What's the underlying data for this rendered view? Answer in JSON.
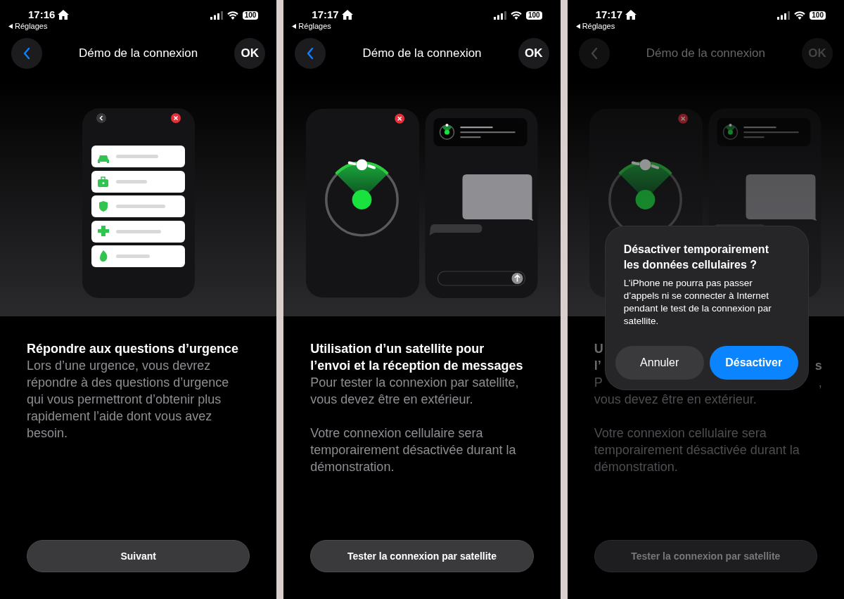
{
  "screens": [
    {
      "time": "17:16",
      "back_app": "Réglages",
      "battery": "100",
      "nav_title": "Démo de la connexion",
      "ok": "OK",
      "dimmed": false,
      "kind": "questions",
      "heading": "Répondre aux questions d’urgence",
      "paragraphs": [
        "Lors d’une urgence, vous devrez répondre à des questions d’urgence qui vous permettront d’obtenir plus rapidement l’aide dont vous avez besoin."
      ],
      "button": "Suivant"
    },
    {
      "time": "17:17",
      "back_app": "Réglages",
      "battery": "100",
      "nav_title": "Démo de la connexion",
      "ok": "OK",
      "dimmed": false,
      "kind": "satellite",
      "heading": "Utilisation d’un satellite pour l’envoi et la réception de messages",
      "paragraphs": [
        "Pour tester la connexion par satellite, vous devez être en extérieur.",
        "Votre connexion cellulaire sera temporairement désactivée durant la démonstration."
      ],
      "button": "Tester la connexion par satellite"
    },
    {
      "time": "17:17",
      "back_app": "Réglages",
      "battery": "100",
      "nav_title": "Démo de la connexion",
      "ok": "OK",
      "dimmed": true,
      "kind": "satellite",
      "covered_lines": [
        {
          "kind": "heading",
          "parts": [
            "U"
          ]
        },
        {
          "kind": "heading",
          "parts": [
            "l’",
            "s"
          ]
        },
        {
          "kind": "text",
          "parts": [
            "P",
            ","
          ]
        }
      ],
      "paragraphs": [
        "vous devez être en extérieur.",
        "Votre connexion cellulaire sera temporairement désactivée durant la démonstration."
      ],
      "button": "Tester la connexion par satellite",
      "dialog": {
        "title": "Désactiver temporairement les données cellulaires ?",
        "message": "L’iPhone ne pourra pas passer d’appels ni se connecter à Internet pendant le test de la connexion par satellite.",
        "buttons": [
          {
            "label": "Annuler",
            "kind": "cancel"
          },
          {
            "label": "Désactiver",
            "kind": "primary"
          }
        ]
      }
    }
  ]
}
